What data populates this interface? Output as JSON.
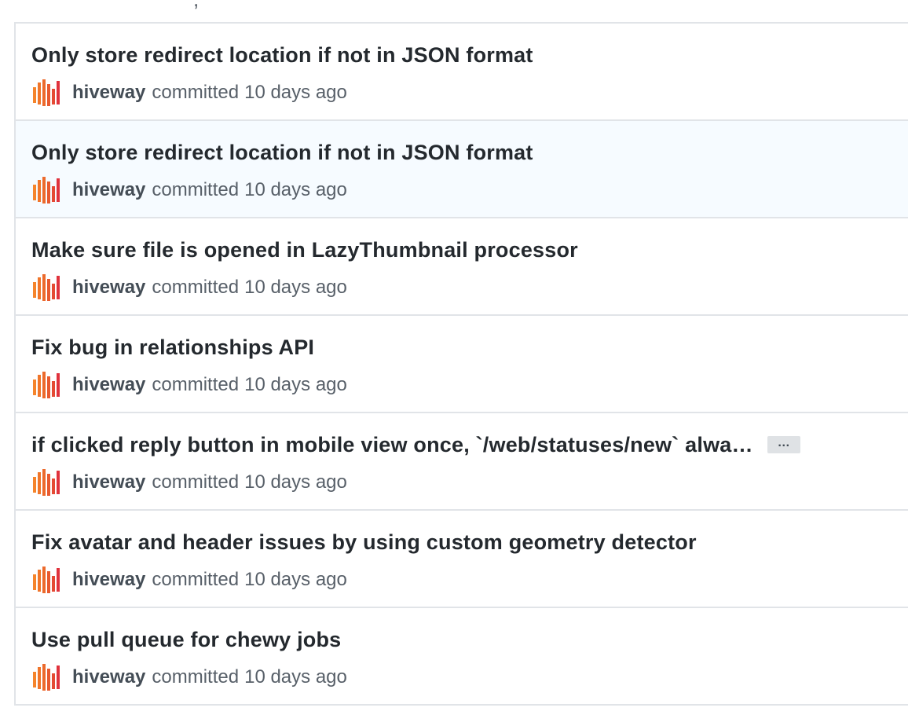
{
  "top_fragment": ",",
  "commit_meta": {
    "committed_label": "committed"
  },
  "commits": [
    {
      "title": "Only store redirect location if not in JSON format",
      "author": "hiveway",
      "time": "10 days ago",
      "highlighted": false,
      "has_expand": false
    },
    {
      "title": "Only store redirect location if not in JSON format",
      "author": "hiveway",
      "time": "10 days ago",
      "highlighted": true,
      "has_expand": false
    },
    {
      "title": "Make sure file is opened in LazyThumbnail processor",
      "author": "hiveway",
      "time": "10 days ago",
      "highlighted": false,
      "has_expand": false
    },
    {
      "title": "Fix bug in relationships API",
      "author": "hiveway",
      "time": "10 days ago",
      "highlighted": false,
      "has_expand": false
    },
    {
      "title": "if clicked reply button in mobile view once, `/web/statuses/new` alwa…",
      "author": "hiveway",
      "time": "10 days ago",
      "highlighted": false,
      "has_expand": true,
      "expand_label": "…"
    },
    {
      "title": "Fix avatar and header issues by using custom geometry detector",
      "author": "hiveway",
      "time": "10 days ago",
      "highlighted": false,
      "has_expand": false
    },
    {
      "title": "Use pull queue for chewy jobs",
      "author": "hiveway",
      "time": "10 days ago",
      "highlighted": false,
      "has_expand": false
    }
  ],
  "colors": {
    "title": "#24292e",
    "author": "#444d56",
    "meta": "#586069",
    "border": "#e1e4e8",
    "highlight_bg": "#f6fbff",
    "avatar_orange": "#f5842b",
    "avatar_red": "#e0323c"
  },
  "icons": {
    "avatar": "hiveway-logo-avatar",
    "expand": "ellipsis-icon"
  }
}
